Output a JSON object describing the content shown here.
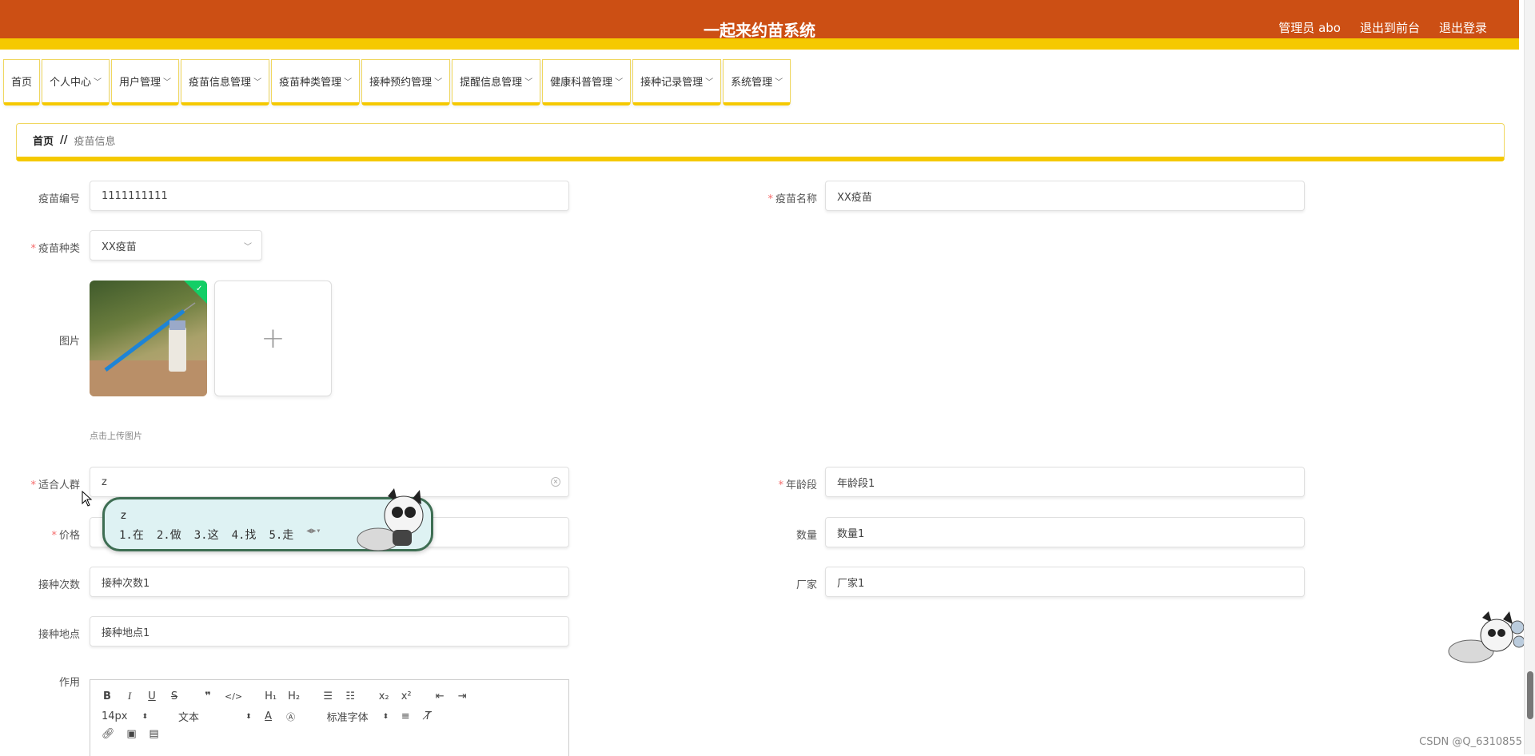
{
  "header": {
    "title": "一起来约苗系统",
    "admin": "管理员 abo",
    "to_front": "退出到前台",
    "logout": "退出登录"
  },
  "nav": [
    "首页",
    "个人中心",
    "用户管理",
    "疫苗信息管理",
    "疫苗种类管理",
    "接种预约管理",
    "提醒信息管理",
    "健康科普管理",
    "接种记录管理",
    "系统管理"
  ],
  "breadcrumb": {
    "home": "首页",
    "sep": "//",
    "current": "疫苗信息"
  },
  "form": {
    "code_label": "疫苗编号",
    "code_value": "1111111111",
    "name_label": "疫苗名称",
    "name_value": "XX疫苗",
    "type_label": "疫苗种类",
    "type_value": "XX疫苗",
    "image_label": "图片",
    "upload_hint": "点击上传图片",
    "crowd_label": "适合人群",
    "crowd_value": "z",
    "age_label": "年龄段",
    "age_value": "年龄段1",
    "price_label": "价格",
    "qty_label": "数量",
    "qty_value": "数量1",
    "times_label": "接种次数",
    "times_value": "接种次数1",
    "maker_label": "厂家",
    "maker_value": "厂家1",
    "place_label": "接种地点",
    "place_value": "接种地点1",
    "effect_label": "作用"
  },
  "ime": {
    "composition": "z",
    "candidates": [
      "1.在",
      "2.做",
      "3.这",
      "4.找",
      "5.走"
    ]
  },
  "editor": {
    "font_size": "14px",
    "block_type": "文本",
    "font_family": "标准字体"
  },
  "watermark": "CSDN @Q_6310855"
}
